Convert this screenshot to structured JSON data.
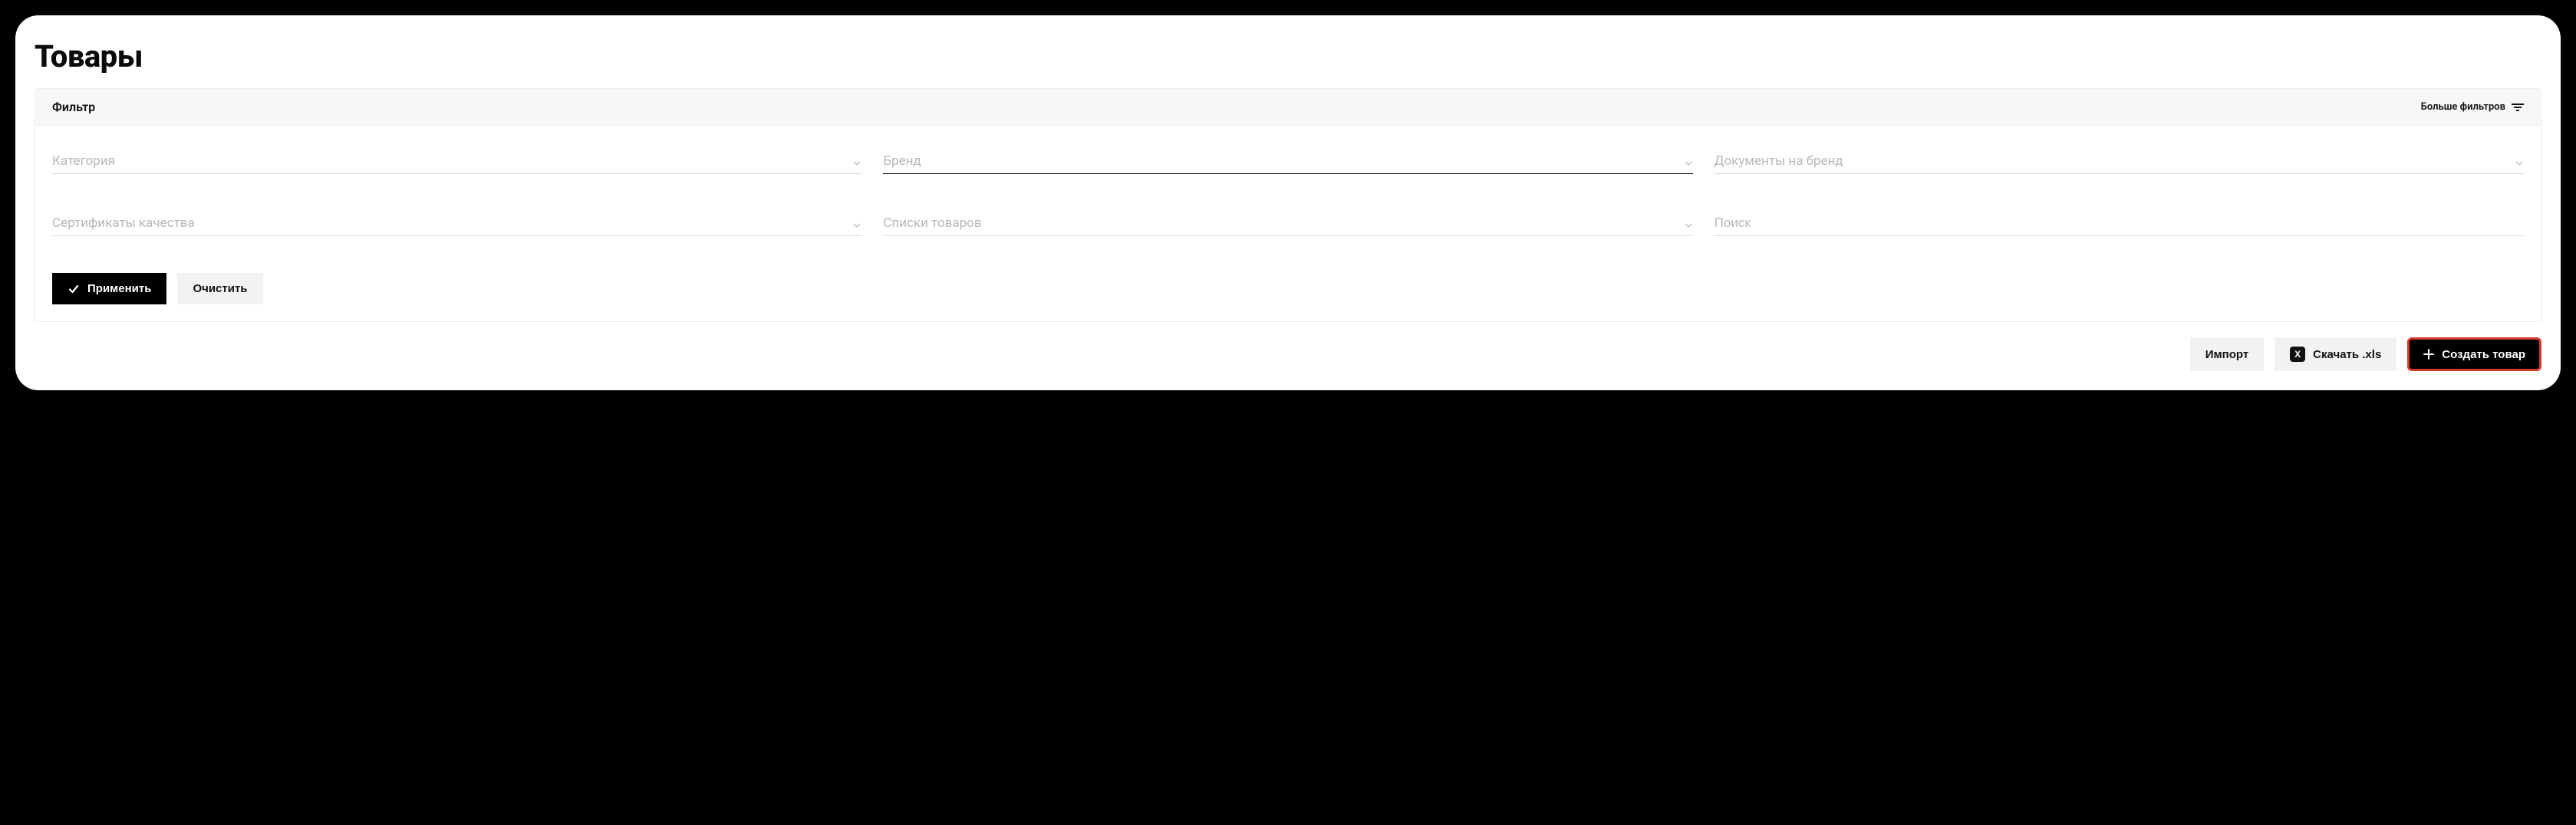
{
  "page": {
    "title": "Товары"
  },
  "filter": {
    "header": {
      "title": "Фильтр",
      "more": "Больше фильтров"
    },
    "fields": {
      "category": {
        "label": "Категория"
      },
      "brand": {
        "label": "Бренд"
      },
      "brand_docs": {
        "label": "Документы на бренд"
      },
      "certs": {
        "label": "Сертификаты качества"
      },
      "lists": {
        "label": "Списки товаров"
      },
      "search": {
        "placeholder": "Поиск"
      }
    },
    "actions": {
      "apply": "Применить",
      "clear": "Очистить"
    }
  },
  "bottom": {
    "import": "Импорт",
    "xls_badge": "X",
    "xls": "Скачать .xls",
    "create": "Создать товар"
  }
}
